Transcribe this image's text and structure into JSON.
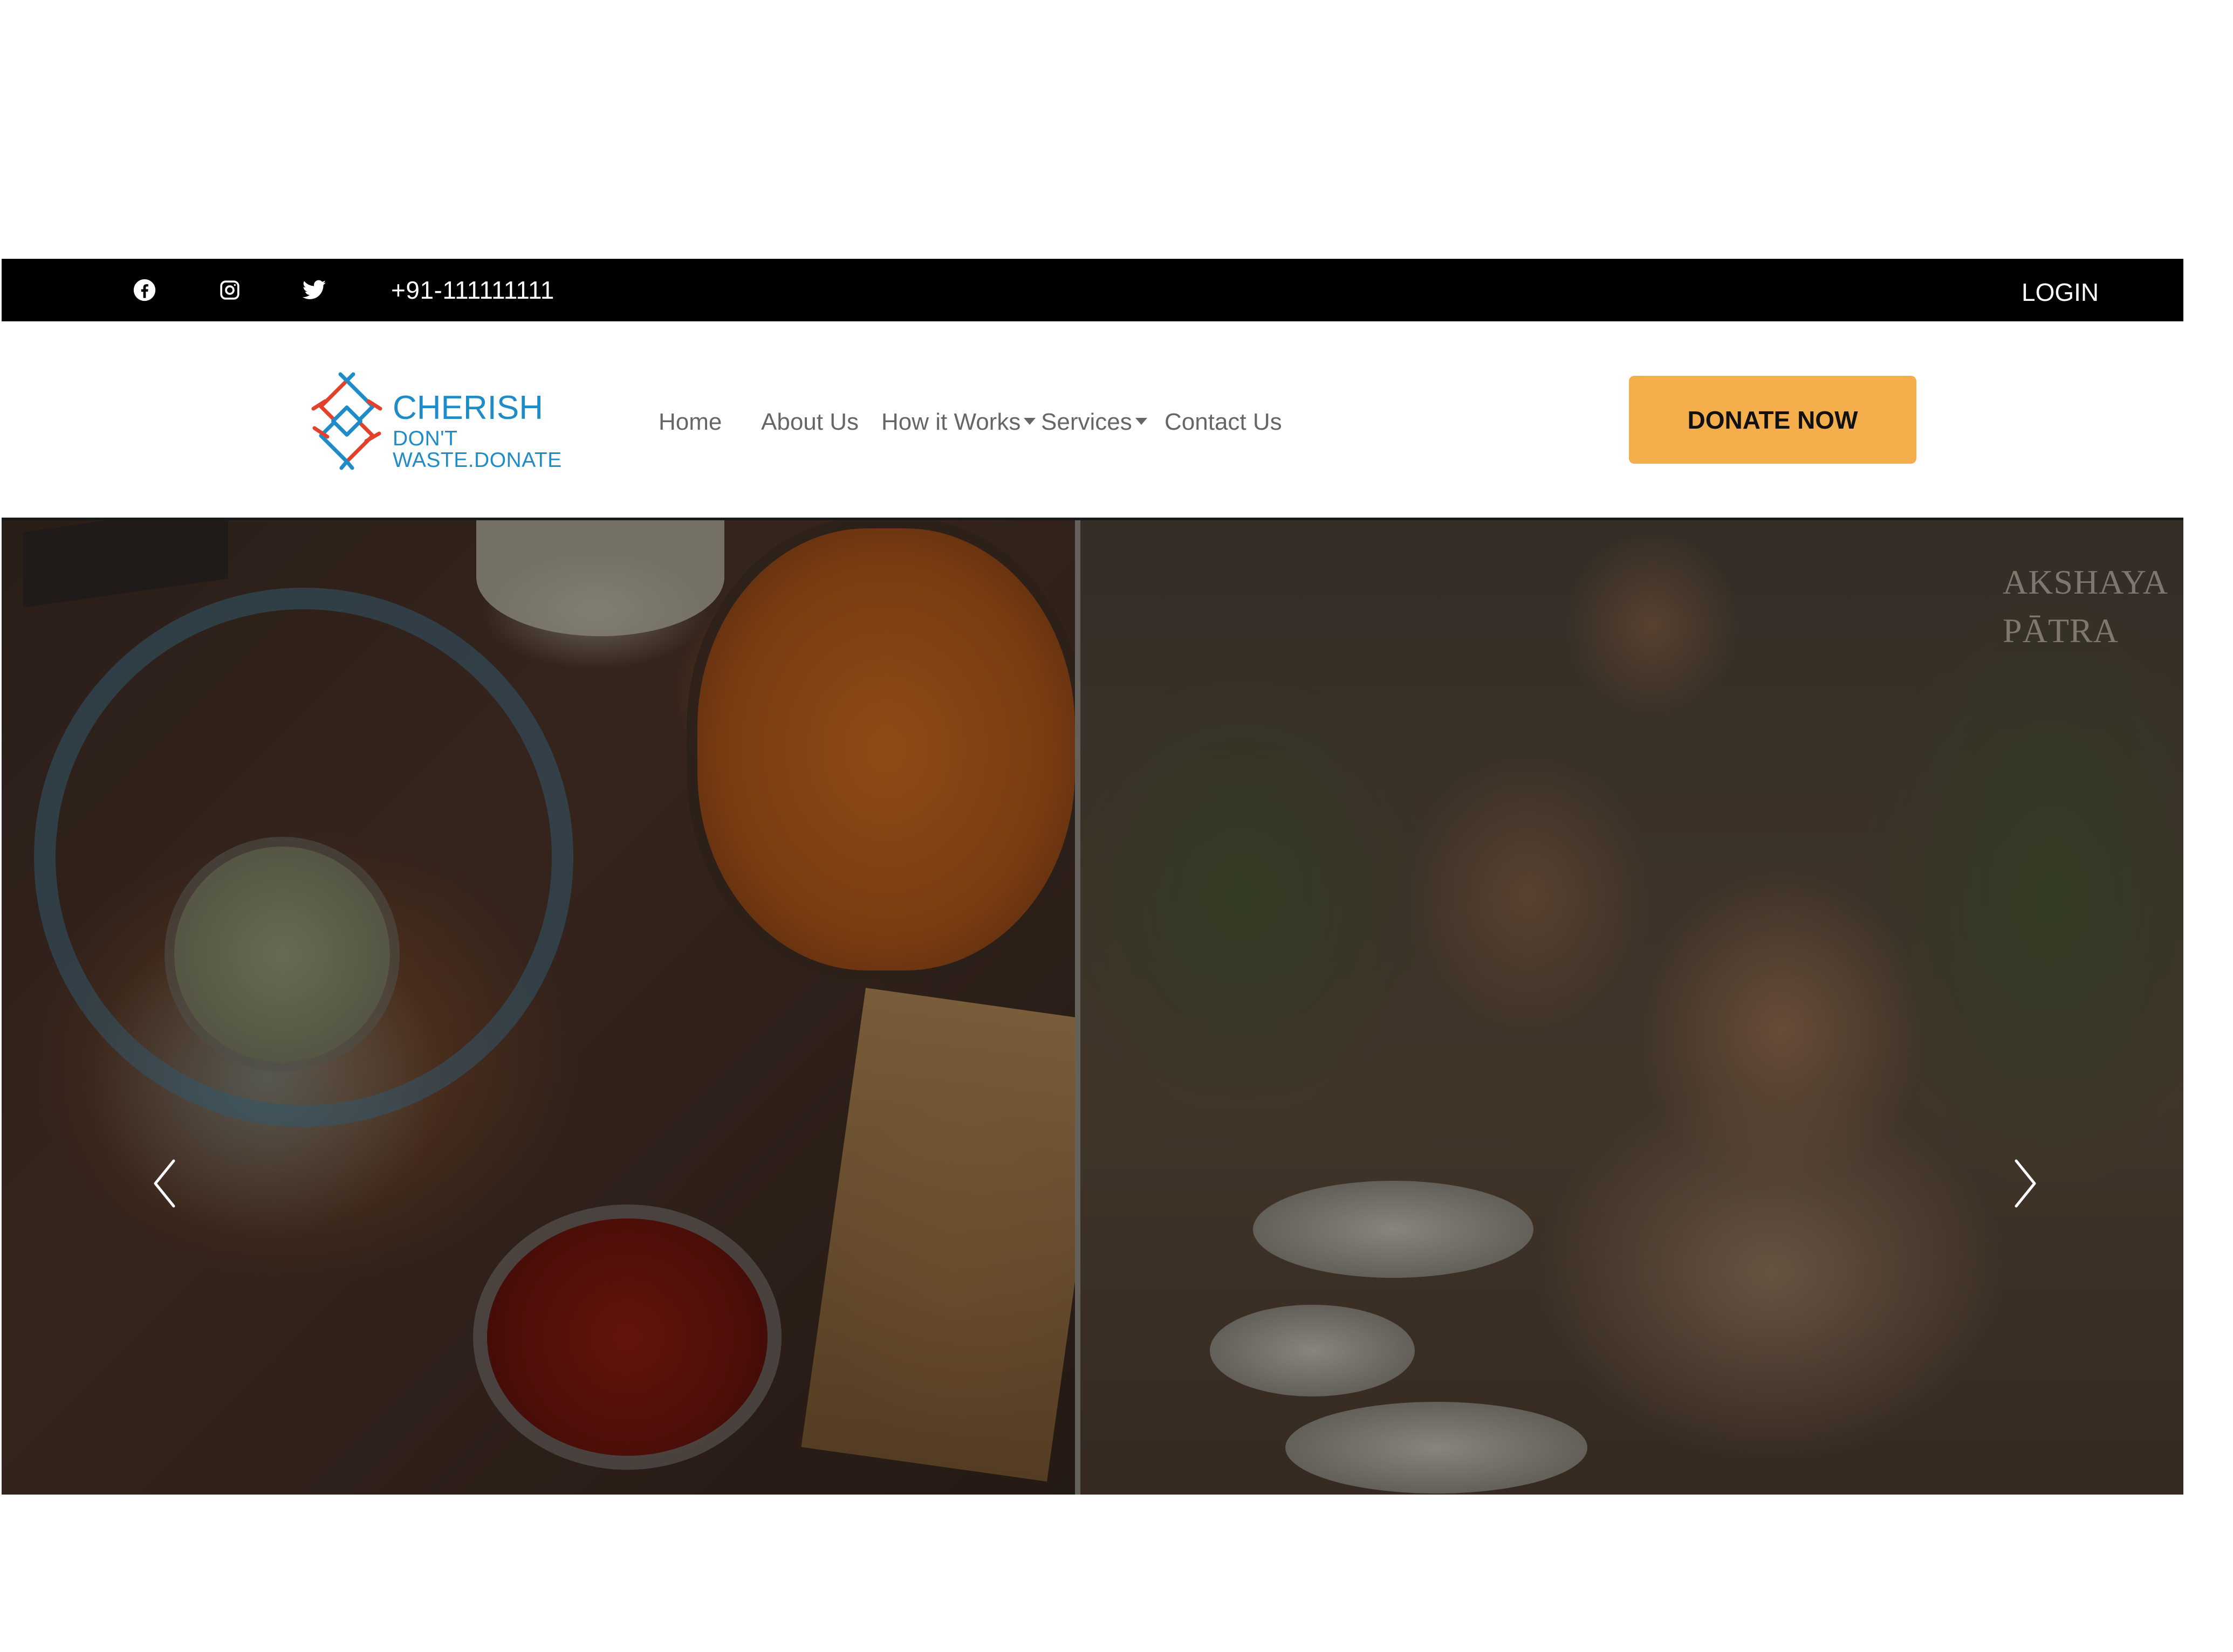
{
  "topbar": {
    "phone": "+91-111111111",
    "login_label": "LOGIN",
    "social_icons": [
      "facebook-icon",
      "instagram-icon",
      "twitter-icon"
    ]
  },
  "navbar": {
    "logo": {
      "name": "CHERISH",
      "tagline": "DON'T WASTE.DONATE"
    },
    "links": [
      {
        "label": "Home",
        "has_dropdown": false
      },
      {
        "label": "About Us",
        "has_dropdown": false
      },
      {
        "label": "How it Works",
        "has_dropdown": true
      },
      {
        "label": "Services",
        "has_dropdown": true
      },
      {
        "label": "Contact Us",
        "has_dropdown": false
      }
    ],
    "donate_label": "DONATE NOW"
  },
  "hero": {
    "watermark": "AKSHAYA\nPĀTRA",
    "prev_icon": "chevron-left-icon",
    "next_icon": "chevron-right-icon"
  },
  "colors": {
    "topbar_bg": "#000000",
    "brand_blue": "#1e8cc8",
    "donate_button": "#f5ae4c",
    "nav_text": "#666666"
  }
}
